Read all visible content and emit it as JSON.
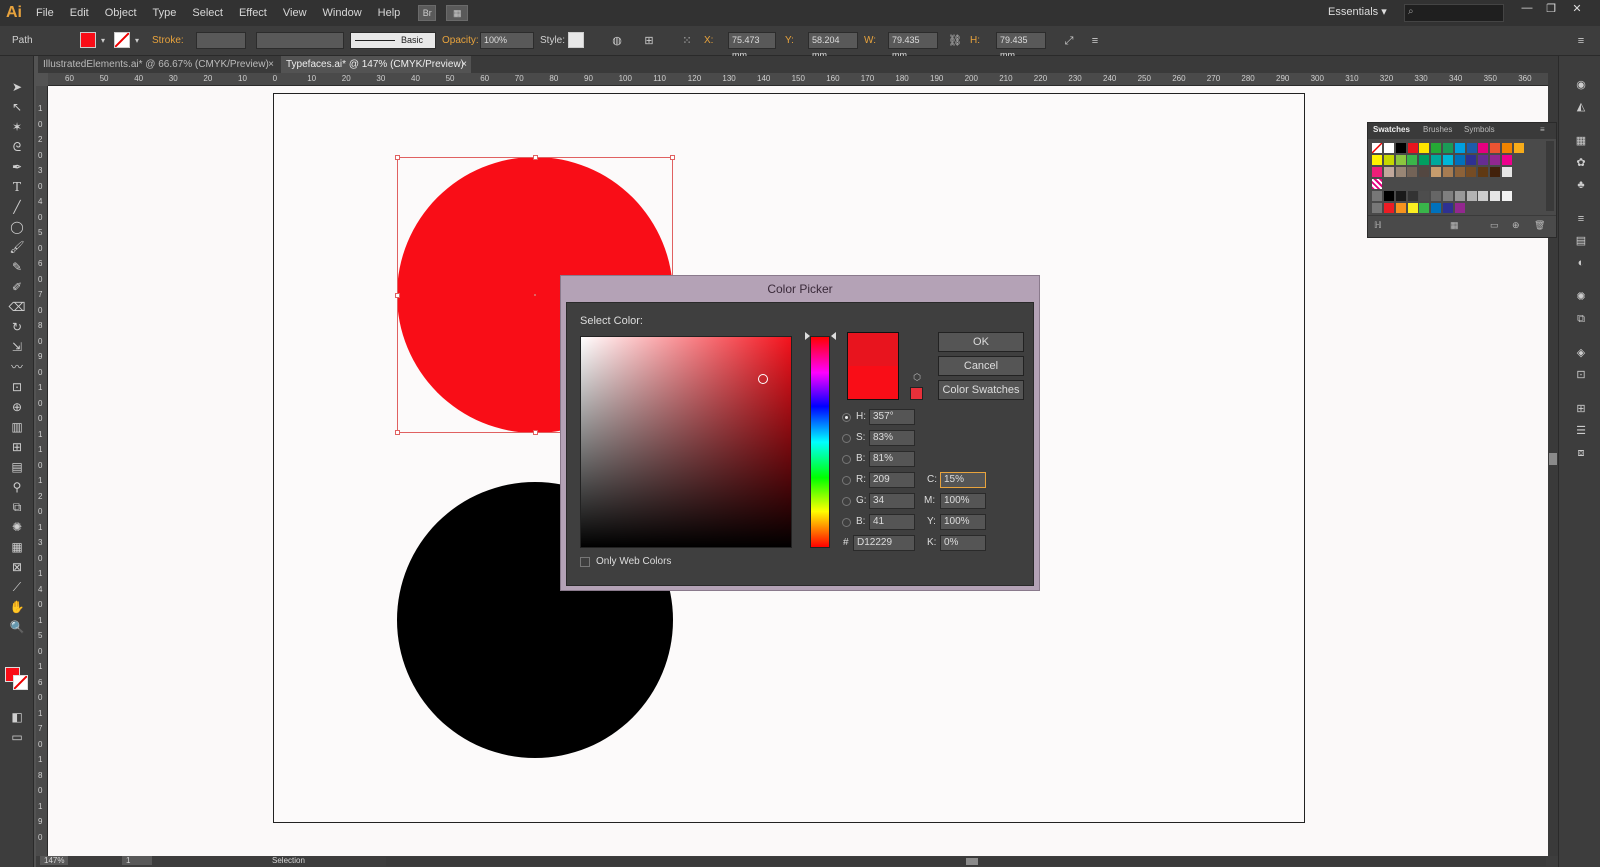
{
  "app": {
    "logo": "Ai",
    "menu": [
      "File",
      "Edit",
      "Object",
      "Type",
      "Select",
      "Effect",
      "View",
      "Window",
      "Help"
    ],
    "bridge_label": "Br",
    "workspace": "Essentials",
    "search_placeholder": ""
  },
  "controlbar": {
    "selection_type": "Path",
    "stroke_label": "Stroke:",
    "brush_style": "Basic",
    "opacity_label": "Opacity:",
    "opacity_value": "100%",
    "style_label": "Style:",
    "x_label": "X:",
    "x_value": "75.473 mm",
    "y_label": "Y:",
    "y_value": "58.204 mm",
    "w_label": "W:",
    "w_value": "79.435 mm",
    "h_label": "H:",
    "h_value": "79.435 mm",
    "fill_color": "#f90d17"
  },
  "tabs": [
    {
      "label": "IllustratedElements.ai* @ 66.67% (CMYK/Preview)",
      "active": false
    },
    {
      "label": "Typefaces.ai* @ 147% (CMYK/Preview)",
      "active": true
    }
  ],
  "ruler": {
    "h_ticks": [
      "60",
      "50",
      "40",
      "30",
      "20",
      "10",
      "0",
      "10",
      "20",
      "30",
      "40",
      "50",
      "60",
      "70",
      "80",
      "90",
      "100",
      "110",
      "120",
      "130",
      "140",
      "150",
      "160",
      "170",
      "180",
      "190",
      "200",
      "210",
      "220",
      "230",
      "240",
      "250",
      "260",
      "270",
      "280",
      "290",
      "300",
      "310",
      "320",
      "330",
      "340",
      "350",
      "360"
    ],
    "v_ticks": [
      "1",
      "0",
      "2",
      "0",
      "3",
      "0",
      "4",
      "0",
      "5",
      "0",
      "6",
      "0",
      "7",
      "0",
      "8",
      "0",
      "9",
      "0",
      "1",
      "0",
      "0",
      "1",
      "1",
      "0",
      "1",
      "2",
      "0",
      "1",
      "3",
      "0",
      "1",
      "4",
      "0",
      "1",
      "5",
      "0",
      "1",
      "6",
      "0",
      "1",
      "7",
      "0",
      "1",
      "8",
      "0",
      "1",
      "9",
      "0"
    ]
  },
  "swatches_panel": {
    "tabs": [
      "Swatches",
      "Brushes",
      "Symbols"
    ],
    "colors_row1": [
      "#ffffff",
      "#000000",
      "#e8141e",
      "#ffe500",
      "#26a935",
      "#1a9b57",
      "#00a0e0",
      "#1c5cab",
      "#e4007f",
      "#ea5432",
      "#f08300",
      "#f7ac1a"
    ],
    "colors_row2": [
      "#fff100",
      "#c6d700",
      "#8cc63f",
      "#3ab54a",
      "#009e60",
      "#00a99d",
      "#00b7d8",
      "#0071bc",
      "#2e3192",
      "#662d91",
      "#92278f",
      "#ec008c"
    ],
    "colors_row3": [
      "#ed1e79",
      "#c1a89b",
      "#998675",
      "#736357",
      "#534741",
      "#c69c6d",
      "#a67c52",
      "#8c6239",
      "#754c24",
      "#603913",
      "#42210b",
      "#e6e6e6"
    ],
    "colors_row5": [
      "#000000",
      "#1a1a1a",
      "#333333",
      "#4d4d4d",
      "#666666",
      "#808080",
      "#999999",
      "#b3b3b3",
      "#cccccc",
      "#e6e6e6",
      "#f2f2f2"
    ],
    "colors_row6": [
      "#ed1c24",
      "#f7931e",
      "#fcee21",
      "#39b54a",
      "#0071bc",
      "#2e3192",
      "#93278f"
    ]
  },
  "color_picker": {
    "title": "Color Picker",
    "select_label": "Select Color:",
    "ok": "OK",
    "cancel": "Cancel",
    "color_swatches": "Color Swatches",
    "h_label": "H:",
    "h_value": "357°",
    "s_label": "S:",
    "s_value": "83%",
    "b_label": "B:",
    "b_value": "81%",
    "r_label": "R:",
    "r_value": "209",
    "g_label": "G:",
    "g_value": "34",
    "bl_label": "B:",
    "bl_value": "41",
    "hex_label": "#",
    "hex_value": "D12229",
    "c_label": "C:",
    "c_value": "15%",
    "m_label": "M:",
    "m_value": "100%",
    "y_label": "Y:",
    "y_value": "100%",
    "k_label": "K:",
    "k_value": "0%",
    "web_colors": "Only Web Colors"
  },
  "status": {
    "zoom": "147%",
    "page": "1",
    "tool": "Selection"
  }
}
